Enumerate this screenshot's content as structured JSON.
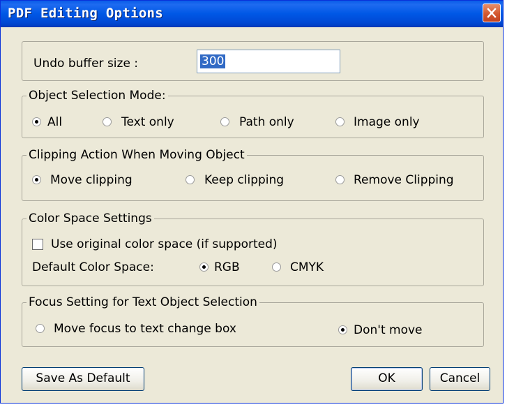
{
  "window": {
    "title": "PDF Editing Options"
  },
  "undo": {
    "label": "Undo buffer size :",
    "value": "300"
  },
  "selection_mode": {
    "legend": "Object Selection Mode:",
    "options": [
      {
        "label": "All",
        "checked": true
      },
      {
        "label": "Text only",
        "checked": false
      },
      {
        "label": "Path only",
        "checked": false
      },
      {
        "label": "Image only",
        "checked": false
      }
    ]
  },
  "clipping": {
    "legend": "Clipping Action When Moving Object",
    "options": [
      {
        "label": "Move clipping",
        "checked": true
      },
      {
        "label": "Keep clipping",
        "checked": false
      },
      {
        "label": "Remove Clipping",
        "checked": false
      }
    ]
  },
  "color_space": {
    "legend": "Color Space Settings",
    "use_original_label": "Use original color space (if supported)",
    "use_original_checked": false,
    "default_label": "Default Color Space:",
    "options": [
      {
        "label": "RGB",
        "checked": true
      },
      {
        "label": "CMYK",
        "checked": false
      }
    ]
  },
  "focus": {
    "legend": "Focus Setting for Text Object Selection",
    "options": [
      {
        "label": "Move focus to text change box",
        "checked": false
      },
      {
        "label": "Don't move",
        "checked": true
      }
    ]
  },
  "buttons": {
    "save_default": "Save As Default",
    "ok": "OK",
    "cancel": "Cancel"
  },
  "icons": {
    "close": "close-icon"
  }
}
